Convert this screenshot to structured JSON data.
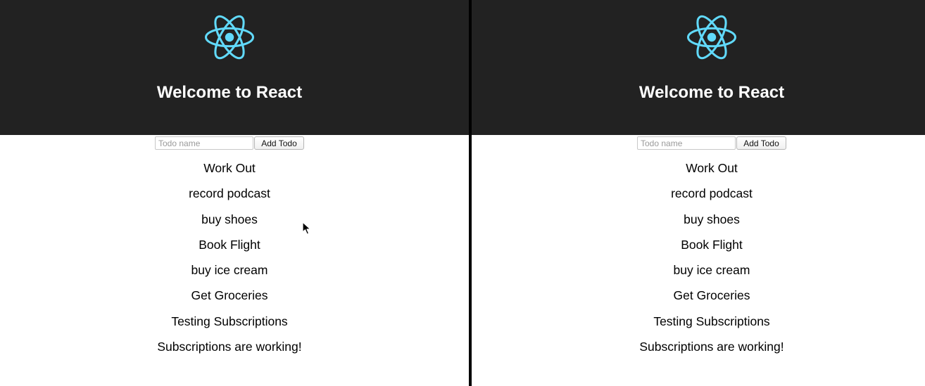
{
  "colors": {
    "header_background": "#222222",
    "react_logo": "#61dafb",
    "divider": "#000000",
    "page_background": "#ffffff"
  },
  "panes": [
    {
      "logo_icon": "react-atom-icon",
      "title": "Welcome to React",
      "form": {
        "input_placeholder": "Todo name",
        "input_value": "",
        "button_label": "Add Todo"
      },
      "todos": [
        "Work Out",
        "record podcast",
        "buy shoes",
        "Book Flight",
        "buy ice cream",
        "Get Groceries",
        "Testing Subscriptions",
        "Subscriptions are working!"
      ]
    },
    {
      "logo_icon": "react-atom-icon",
      "title": "Welcome to React",
      "form": {
        "input_placeholder": "Todo name",
        "input_value": "",
        "button_label": "Add Todo"
      },
      "todos": [
        "Work Out",
        "record podcast",
        "buy shoes",
        "Book Flight",
        "buy ice cream",
        "Get Groceries",
        "Testing Subscriptions",
        "Subscriptions are working!"
      ]
    }
  ],
  "cursor_icon": "mouse-pointer-icon"
}
